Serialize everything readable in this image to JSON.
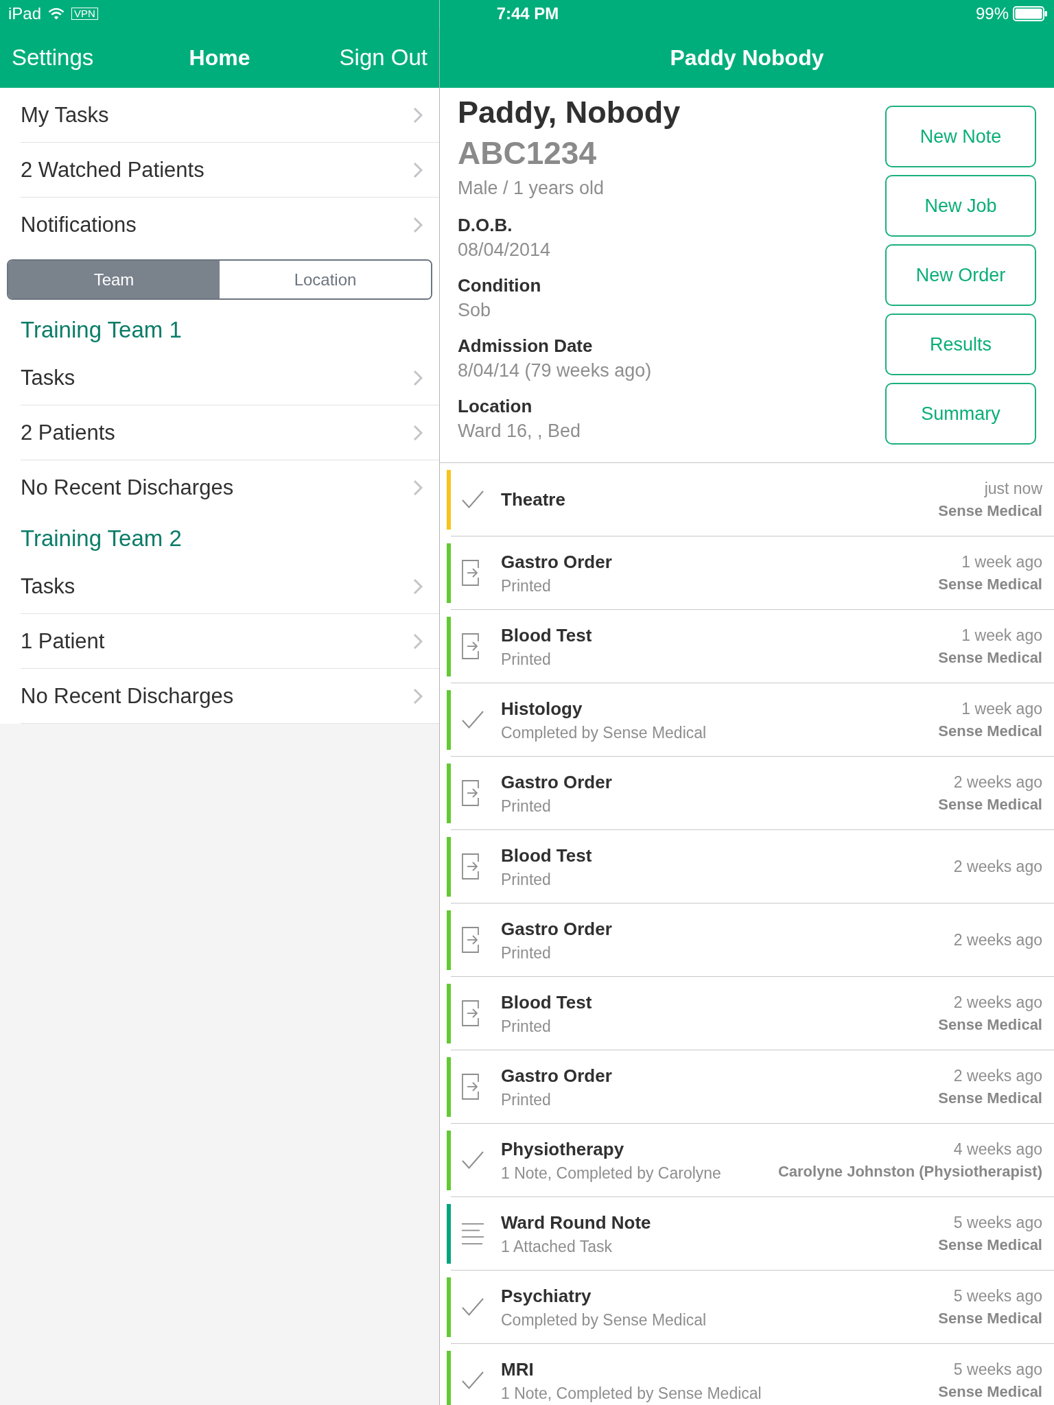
{
  "status_bar": {
    "device": "iPad",
    "vpn": "VPN",
    "time": "7:44 PM",
    "battery": "99%"
  },
  "sidebar": {
    "nav": {
      "left_button": "Settings",
      "title": "Home",
      "right_button": "Sign Out"
    },
    "items": [
      "My Tasks",
      "2 Watched Patients",
      "Notifications"
    ],
    "segments": [
      {
        "label": "Team",
        "selected": true
      },
      {
        "label": "Location",
        "selected": false
      }
    ],
    "teams": [
      {
        "name": "Training Team 1",
        "items": [
          "Tasks",
          "2 Patients",
          "No Recent Discharges"
        ]
      },
      {
        "name": "Training Team 2",
        "items": [
          "Tasks",
          "1 Patient",
          "No Recent Discharges"
        ]
      }
    ]
  },
  "patient": {
    "nav_title": "Paddy Nobody",
    "name": "Paddy, Nobody",
    "id": "ABC1234",
    "summary": "Male / 1 years old",
    "fields": [
      {
        "label": "D.O.B.",
        "value": "08/04/2014"
      },
      {
        "label": "Condition",
        "value": "Sob"
      },
      {
        "label": "Admission Date",
        "value": "8/04/14 (79 weeks ago)"
      },
      {
        "label": "Location",
        "value": "Ward 16, , Bed"
      }
    ],
    "actions": [
      "New Note",
      "New Job",
      "New Order",
      "Results",
      "Summary"
    ]
  },
  "timeline": [
    {
      "kind": "check",
      "color": "#f8c31c",
      "title": "Theatre",
      "time": "just now",
      "author": "Sense Medical"
    },
    {
      "kind": "order",
      "color": "#62c932",
      "title": "Gastro Order",
      "subtitle": "Printed",
      "time": "1 week ago",
      "author": "Sense Medical"
    },
    {
      "kind": "order",
      "color": "#62c932",
      "title": "Blood Test",
      "subtitle": "Printed",
      "time": "1 week ago",
      "author": "Sense Medical"
    },
    {
      "kind": "check",
      "color": "#62c932",
      "title": "Histology",
      "subtitle": "Completed by Sense Medical",
      "time": "1 week ago",
      "author": "Sense Medical"
    },
    {
      "kind": "order",
      "color": "#62c932",
      "title": "Gastro Order",
      "subtitle": "Printed",
      "time": "2 weeks ago",
      "author": "Sense Medical"
    },
    {
      "kind": "order",
      "color": "#62c932",
      "title": "Blood Test",
      "subtitle": "Printed",
      "time": "2 weeks ago"
    },
    {
      "kind": "order",
      "color": "#62c932",
      "title": "Gastro Order",
      "subtitle": "Printed",
      "time": "2 weeks ago"
    },
    {
      "kind": "order",
      "color": "#62c932",
      "title": "Blood Test",
      "subtitle": "Printed",
      "time": "2 weeks ago",
      "author": "Sense Medical"
    },
    {
      "kind": "order",
      "color": "#62c932",
      "title": "Gastro Order",
      "subtitle": "Printed",
      "time": "2 weeks ago",
      "author": "Sense Medical"
    },
    {
      "kind": "check",
      "color": "#62c932",
      "title": "Physiotherapy",
      "subtitle": "1 Note, Completed by Carolyne",
      "time": "4 weeks ago",
      "author": "Carolyne Johnston (Physiotherapist)"
    },
    {
      "kind": "note",
      "color": "#00a47f",
      "title": "Ward Round Note",
      "subtitle": "1 Attached Task",
      "time": "5 weeks ago",
      "author": "Sense Medical"
    },
    {
      "kind": "check",
      "color": "#62c932",
      "title": "Psychiatry",
      "subtitle": "Completed by Sense Medical",
      "time": "5 weeks ago",
      "author": "Sense Medical"
    },
    {
      "kind": "check",
      "color": "#62c932",
      "title": "MRI",
      "subtitle": "1 Note, Completed by Sense Medical",
      "time": "5 weeks ago",
      "author": "Sense Medical"
    }
  ]
}
